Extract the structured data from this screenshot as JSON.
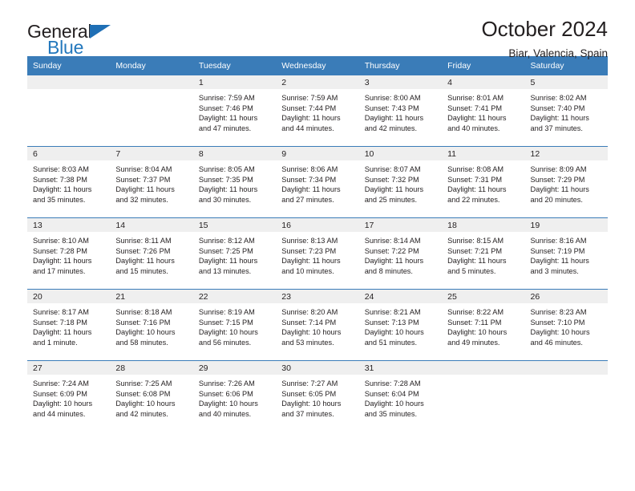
{
  "brand": {
    "name_part1": "General",
    "name_part2": "Blue",
    "mark": "triangle-logo"
  },
  "header": {
    "title": "October 2024",
    "subtitle": "Biar, Valencia, Spain"
  },
  "weekdays": [
    "Sunday",
    "Monday",
    "Tuesday",
    "Wednesday",
    "Thursday",
    "Friday",
    "Saturday"
  ],
  "colors": {
    "header_blue": "#3a7cb8",
    "brand_blue": "#2378bd",
    "daystrip_gray": "#efefef",
    "text": "#231f20"
  },
  "weeks": [
    [
      {
        "day": "",
        "sunrise": "",
        "sunset": "",
        "daylight_1": "",
        "daylight_2": ""
      },
      {
        "day": "",
        "sunrise": "",
        "sunset": "",
        "daylight_1": "",
        "daylight_2": ""
      },
      {
        "day": "1",
        "sunrise": "Sunrise: 7:59 AM",
        "sunset": "Sunset: 7:46 PM",
        "daylight_1": "Daylight: 11 hours",
        "daylight_2": "and 47 minutes."
      },
      {
        "day": "2",
        "sunrise": "Sunrise: 7:59 AM",
        "sunset": "Sunset: 7:44 PM",
        "daylight_1": "Daylight: 11 hours",
        "daylight_2": "and 44 minutes."
      },
      {
        "day": "3",
        "sunrise": "Sunrise: 8:00 AM",
        "sunset": "Sunset: 7:43 PM",
        "daylight_1": "Daylight: 11 hours",
        "daylight_2": "and 42 minutes."
      },
      {
        "day": "4",
        "sunrise": "Sunrise: 8:01 AM",
        "sunset": "Sunset: 7:41 PM",
        "daylight_1": "Daylight: 11 hours",
        "daylight_2": "and 40 minutes."
      },
      {
        "day": "5",
        "sunrise": "Sunrise: 8:02 AM",
        "sunset": "Sunset: 7:40 PM",
        "daylight_1": "Daylight: 11 hours",
        "daylight_2": "and 37 minutes."
      }
    ],
    [
      {
        "day": "6",
        "sunrise": "Sunrise: 8:03 AM",
        "sunset": "Sunset: 7:38 PM",
        "daylight_1": "Daylight: 11 hours",
        "daylight_2": "and 35 minutes."
      },
      {
        "day": "7",
        "sunrise": "Sunrise: 8:04 AM",
        "sunset": "Sunset: 7:37 PM",
        "daylight_1": "Daylight: 11 hours",
        "daylight_2": "and 32 minutes."
      },
      {
        "day": "8",
        "sunrise": "Sunrise: 8:05 AM",
        "sunset": "Sunset: 7:35 PM",
        "daylight_1": "Daylight: 11 hours",
        "daylight_2": "and 30 minutes."
      },
      {
        "day": "9",
        "sunrise": "Sunrise: 8:06 AM",
        "sunset": "Sunset: 7:34 PM",
        "daylight_1": "Daylight: 11 hours",
        "daylight_2": "and 27 minutes."
      },
      {
        "day": "10",
        "sunrise": "Sunrise: 8:07 AM",
        "sunset": "Sunset: 7:32 PM",
        "daylight_1": "Daylight: 11 hours",
        "daylight_2": "and 25 minutes."
      },
      {
        "day": "11",
        "sunrise": "Sunrise: 8:08 AM",
        "sunset": "Sunset: 7:31 PM",
        "daylight_1": "Daylight: 11 hours",
        "daylight_2": "and 22 minutes."
      },
      {
        "day": "12",
        "sunrise": "Sunrise: 8:09 AM",
        "sunset": "Sunset: 7:29 PM",
        "daylight_1": "Daylight: 11 hours",
        "daylight_2": "and 20 minutes."
      }
    ],
    [
      {
        "day": "13",
        "sunrise": "Sunrise: 8:10 AM",
        "sunset": "Sunset: 7:28 PM",
        "daylight_1": "Daylight: 11 hours",
        "daylight_2": "and 17 minutes."
      },
      {
        "day": "14",
        "sunrise": "Sunrise: 8:11 AM",
        "sunset": "Sunset: 7:26 PM",
        "daylight_1": "Daylight: 11 hours",
        "daylight_2": "and 15 minutes."
      },
      {
        "day": "15",
        "sunrise": "Sunrise: 8:12 AM",
        "sunset": "Sunset: 7:25 PM",
        "daylight_1": "Daylight: 11 hours",
        "daylight_2": "and 13 minutes."
      },
      {
        "day": "16",
        "sunrise": "Sunrise: 8:13 AM",
        "sunset": "Sunset: 7:23 PM",
        "daylight_1": "Daylight: 11 hours",
        "daylight_2": "and 10 minutes."
      },
      {
        "day": "17",
        "sunrise": "Sunrise: 8:14 AM",
        "sunset": "Sunset: 7:22 PM",
        "daylight_1": "Daylight: 11 hours",
        "daylight_2": "and 8 minutes."
      },
      {
        "day": "18",
        "sunrise": "Sunrise: 8:15 AM",
        "sunset": "Sunset: 7:21 PM",
        "daylight_1": "Daylight: 11 hours",
        "daylight_2": "and 5 minutes."
      },
      {
        "day": "19",
        "sunrise": "Sunrise: 8:16 AM",
        "sunset": "Sunset: 7:19 PM",
        "daylight_1": "Daylight: 11 hours",
        "daylight_2": "and 3 minutes."
      }
    ],
    [
      {
        "day": "20",
        "sunrise": "Sunrise: 8:17 AM",
        "sunset": "Sunset: 7:18 PM",
        "daylight_1": "Daylight: 11 hours",
        "daylight_2": "and 1 minute."
      },
      {
        "day": "21",
        "sunrise": "Sunrise: 8:18 AM",
        "sunset": "Sunset: 7:16 PM",
        "daylight_1": "Daylight: 10 hours",
        "daylight_2": "and 58 minutes."
      },
      {
        "day": "22",
        "sunrise": "Sunrise: 8:19 AM",
        "sunset": "Sunset: 7:15 PM",
        "daylight_1": "Daylight: 10 hours",
        "daylight_2": "and 56 minutes."
      },
      {
        "day": "23",
        "sunrise": "Sunrise: 8:20 AM",
        "sunset": "Sunset: 7:14 PM",
        "daylight_1": "Daylight: 10 hours",
        "daylight_2": "and 53 minutes."
      },
      {
        "day": "24",
        "sunrise": "Sunrise: 8:21 AM",
        "sunset": "Sunset: 7:13 PM",
        "daylight_1": "Daylight: 10 hours",
        "daylight_2": "and 51 minutes."
      },
      {
        "day": "25",
        "sunrise": "Sunrise: 8:22 AM",
        "sunset": "Sunset: 7:11 PM",
        "daylight_1": "Daylight: 10 hours",
        "daylight_2": "and 49 minutes."
      },
      {
        "day": "26",
        "sunrise": "Sunrise: 8:23 AM",
        "sunset": "Sunset: 7:10 PM",
        "daylight_1": "Daylight: 10 hours",
        "daylight_2": "and 46 minutes."
      }
    ],
    [
      {
        "day": "27",
        "sunrise": "Sunrise: 7:24 AM",
        "sunset": "Sunset: 6:09 PM",
        "daylight_1": "Daylight: 10 hours",
        "daylight_2": "and 44 minutes."
      },
      {
        "day": "28",
        "sunrise": "Sunrise: 7:25 AM",
        "sunset": "Sunset: 6:08 PM",
        "daylight_1": "Daylight: 10 hours",
        "daylight_2": "and 42 minutes."
      },
      {
        "day": "29",
        "sunrise": "Sunrise: 7:26 AM",
        "sunset": "Sunset: 6:06 PM",
        "daylight_1": "Daylight: 10 hours",
        "daylight_2": "and 40 minutes."
      },
      {
        "day": "30",
        "sunrise": "Sunrise: 7:27 AM",
        "sunset": "Sunset: 6:05 PM",
        "daylight_1": "Daylight: 10 hours",
        "daylight_2": "and 37 minutes."
      },
      {
        "day": "31",
        "sunrise": "Sunrise: 7:28 AM",
        "sunset": "Sunset: 6:04 PM",
        "daylight_1": "Daylight: 10 hours",
        "daylight_2": "and 35 minutes."
      },
      {
        "day": "",
        "sunrise": "",
        "sunset": "",
        "daylight_1": "",
        "daylight_2": ""
      },
      {
        "day": "",
        "sunrise": "",
        "sunset": "",
        "daylight_1": "",
        "daylight_2": ""
      }
    ]
  ]
}
